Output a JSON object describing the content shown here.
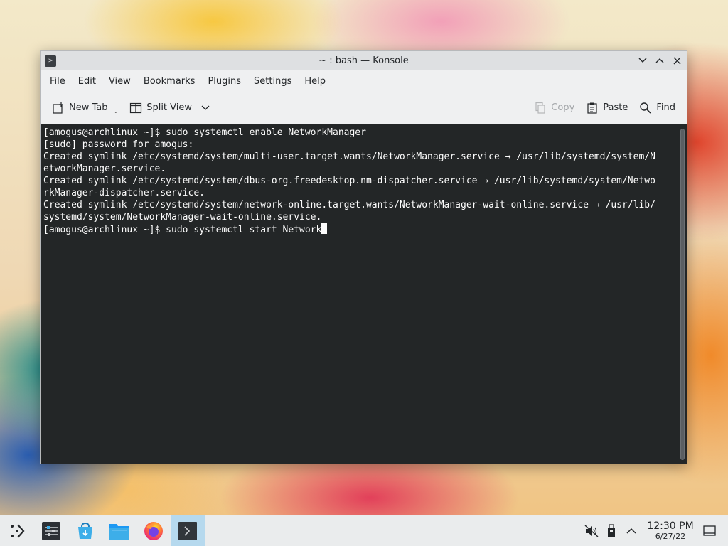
{
  "window": {
    "title": "~ : bash — Konsole"
  },
  "menubar": {
    "items": [
      "File",
      "Edit",
      "View",
      "Bookmarks",
      "Plugins",
      "Settings",
      "Help"
    ]
  },
  "toolbar": {
    "new_tab": "New Tab",
    "split_view": "Split View",
    "copy": "Copy",
    "paste": "Paste",
    "find": "Find"
  },
  "terminal": {
    "lines": [
      "[amogus@archlinux ~]$ sudo systemctl enable NetworkManager",
      "[sudo] password for amogus:",
      "Created symlink /etc/systemd/system/multi-user.target.wants/NetworkManager.service → /usr/lib/systemd/system/N",
      "etworkManager.service.",
      "Created symlink /etc/systemd/system/dbus-org.freedesktop.nm-dispatcher.service → /usr/lib/systemd/system/Netwo",
      "rkManager-dispatcher.service.",
      "Created symlink /etc/systemd/system/network-online.target.wants/NetworkManager-wait-online.service → /usr/lib/",
      "systemd/system/NetworkManager-wait-online.service.",
      "[amogus@archlinux ~]$ sudo systemctl start Network"
    ]
  },
  "taskbar": {
    "apps": [
      {
        "name": "application-launcher-icon"
      },
      {
        "name": "system-settings-icon"
      },
      {
        "name": "discover-store-icon"
      },
      {
        "name": "file-manager-icon"
      },
      {
        "name": "firefox-icon"
      },
      {
        "name": "konsole-icon"
      }
    ],
    "clock_time": "12:30 PM",
    "clock_date": "6/27/22"
  },
  "colors": {
    "terminal_bg": "#232627",
    "terminal_fg": "#fcfcfc",
    "active_task": "#b6d9ee"
  }
}
